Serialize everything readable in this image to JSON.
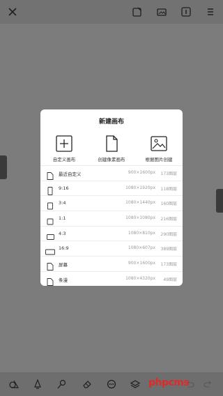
{
  "dialog": {
    "title": "新建画布",
    "quick_actions": [
      {
        "label": "自定义画布",
        "icon": "plus-square-icon"
      },
      {
        "label": "创建像素画布",
        "icon": "document-icon"
      },
      {
        "label": "根据图片创建",
        "icon": "image-icon"
      }
    ],
    "presets": [
      {
        "name": "最近自定义",
        "size": "900×1600px",
        "layers": "173图层",
        "icon": "document-icon"
      },
      {
        "name": "9:16",
        "size": "1080×1920px",
        "layers": "118图层",
        "icon": "portrait-ratio-icon"
      },
      {
        "name": "3:4",
        "size": "1080×1440px",
        "layers": "160图层",
        "icon": "portrait-3-4-icon"
      },
      {
        "name": "1:1",
        "size": "1080×1080px",
        "layers": "216图层",
        "icon": "square-ratio-icon"
      },
      {
        "name": "4:3",
        "size": "1080×810px",
        "layers": "290图层",
        "icon": "landscape-4-3-icon"
      },
      {
        "name": "16:9",
        "size": "1080×607px",
        "layers": "389图层",
        "icon": "landscape-16-9-icon"
      },
      {
        "name": "屏幕",
        "size": "900×1600px",
        "layers": "173图层",
        "icon": "document-icon"
      },
      {
        "name": "条漫",
        "size": "1080×4320px",
        "layers": "49图层",
        "icon": "document-icon"
      }
    ]
  },
  "topbar": {
    "icons": [
      "close-icon",
      "edit-canvas-icon",
      "gallery-icon",
      "info-icon",
      "menu-icon"
    ]
  },
  "bottombar": {
    "icons": [
      "shapes-tool-icon",
      "brush-tool-icon",
      "smudge-tool-icon",
      "eraser-tool-icon",
      "filter-tool-icon",
      "layers-icon",
      "undo-icon",
      "redo-icon"
    ]
  },
  "watermark": "phpcms"
}
